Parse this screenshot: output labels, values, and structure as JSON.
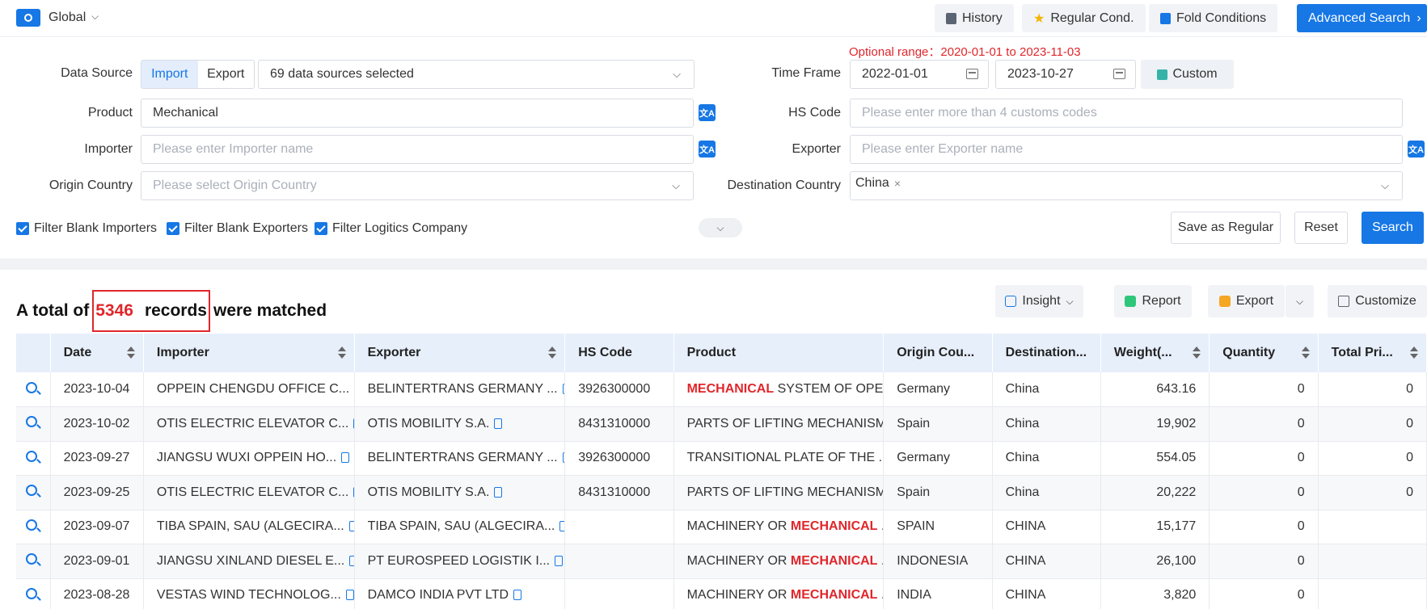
{
  "topbar": {
    "scope": "Global",
    "history": "History",
    "regular_cond": "Regular Cond.",
    "fold_conditions": "Fold Conditions",
    "advanced_search": "Advanced Search"
  },
  "form": {
    "data_source_label": "Data Source",
    "import": "Import",
    "export": "Export",
    "data_sources": "69 data sources selected",
    "product_label": "Product",
    "product_value": "Mechanical",
    "importer_label": "Importer",
    "importer_placeholder": "Please enter Importer name",
    "origin_label": "Origin Country",
    "origin_placeholder": "Please select Origin Country",
    "optional_range": "Optional range：2020-01-01 to 2023-11-03",
    "timeframe_label": "Time Frame",
    "date_from": "2022-01-01",
    "date_to": "2023-10-27",
    "custom": "Custom",
    "hs_label": "HS Code",
    "hs_placeholder": "Please enter more than 4 customs codes",
    "exporter_label": "Exporter",
    "exporter_placeholder": "Please enter Exporter name",
    "dest_label": "Destination Country",
    "dest_tag": "China",
    "filter_importers": "Filter Blank Importers",
    "filter_exporters": "Filter Blank Exporters",
    "filter_logistics": "Filter Logitics Company",
    "save_regular": "Save as Regular",
    "reset": "Reset",
    "search": "Search"
  },
  "results": {
    "prefix": "A total of",
    "count": "5346",
    "records": "records",
    "suffix": "were matched",
    "insight": "Insight",
    "report": "Report",
    "export": "Export",
    "customize": "Customize"
  },
  "table": {
    "headers": [
      "Date",
      "Importer",
      "Exporter",
      "HS Code",
      "Product",
      "Origin Cou...",
      "Destination...",
      "Weight(...",
      "Quantity",
      "Total Pri..."
    ],
    "rows": [
      {
        "date": "2023-10-04",
        "importer": "OPPEIN CHENGDU OFFICE C...",
        "exporter": "BELINTERTRANS GERMANY ...",
        "hs": "3926300000",
        "product_pre": "",
        "product_hl": "MECHANICAL",
        "product_post": " SYSTEM OF OPE...",
        "origin": "Germany",
        "dest": "China",
        "weight": "643.16",
        "qty": "0",
        "total": "0"
      },
      {
        "date": "2023-10-02",
        "importer": "OTIS ELECTRIC ELEVATOR C...",
        "exporter": "OTIS MOBILITY S.A.",
        "hs": "8431310000",
        "product_pre": "PARTS OF LIFTING MECHANISM...",
        "product_hl": "",
        "product_post": "",
        "origin": "Spain",
        "dest": "China",
        "weight": "19,902",
        "qty": "0",
        "total": "0"
      },
      {
        "date": "2023-09-27",
        "importer": "JIANGSU WUXI OPPEIN HO...",
        "exporter": "BELINTERTRANS GERMANY ...",
        "hs": "3926300000",
        "product_pre": "TRANSITIONAL PLATE OF THE ...",
        "product_hl": "",
        "product_post": "",
        "origin": "Germany",
        "dest": "China",
        "weight": "554.05",
        "qty": "0",
        "total": "0"
      },
      {
        "date": "2023-09-25",
        "importer": "OTIS ELECTRIC ELEVATOR C...",
        "exporter": "OTIS MOBILITY S.A.",
        "hs": "8431310000",
        "product_pre": "PARTS OF LIFTING MECHANISM...",
        "product_hl": "",
        "product_post": "",
        "origin": "Spain",
        "dest": "China",
        "weight": "20,222",
        "qty": "0",
        "total": "0"
      },
      {
        "date": "2023-09-07",
        "importer": "TIBA SPAIN, SAU (ALGECIRA...",
        "exporter": "TIBA SPAIN, SAU (ALGECIRA...",
        "hs": "",
        "product_pre": "MACHINERY OR ",
        "product_hl": "MECHANICAL",
        "product_post": " ...",
        "origin": "SPAIN",
        "dest": "CHINA",
        "weight": "15,177",
        "qty": "0",
        "total": ""
      },
      {
        "date": "2023-09-01",
        "importer": "JIANGSU XINLAND DIESEL E...",
        "exporter": "PT EUROSPEED LOGISTIK I...",
        "hs": "",
        "product_pre": "MACHINERY OR ",
        "product_hl": "MECHANICAL",
        "product_post": " ...",
        "origin": "INDONESIA",
        "dest": "CHINA",
        "weight": "26,100",
        "qty": "0",
        "total": ""
      },
      {
        "date": "2023-08-28",
        "importer": "VESTAS WIND TECHNOLOG...",
        "exporter": "DAMCO INDIA PVT LTD",
        "hs": "",
        "product_pre": "MACHINERY OR ",
        "product_hl": "MECHANICAL",
        "product_post": " ...",
        "origin": "INDIA",
        "dest": "CHINA",
        "weight": "3,820",
        "qty": "0",
        "total": ""
      }
    ]
  },
  "colors": {
    "primary": "#1677e5",
    "highlight": "#e0262b"
  }
}
